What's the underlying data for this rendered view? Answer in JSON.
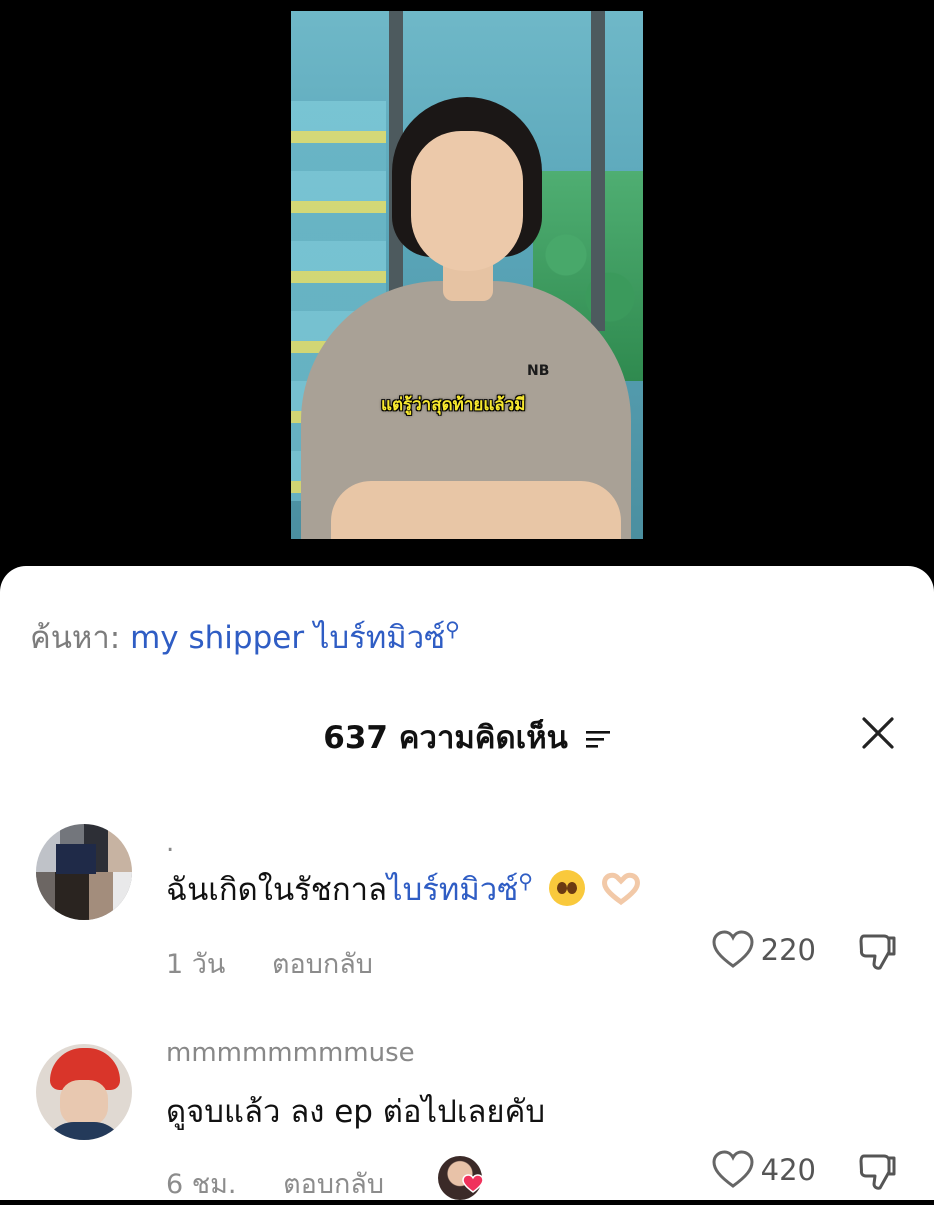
{
  "video": {
    "subtitle": "แต่รู้ว่าสุดท้ายแล้วมี",
    "shirt_logo": "NB"
  },
  "search": {
    "prefix": "ค้นหา:",
    "term": "my shipper ไบร์ทมิวซ์",
    "icon": "search-icon"
  },
  "comments_header": {
    "count_label": "637 ความคิดเห็น",
    "sort_icon": "sort-icon",
    "close_icon": "close-icon"
  },
  "comments": [
    {
      "username": ".",
      "text_plain": "ฉันเกิดในรัชกาล",
      "text_link": "ไบร์ทมิวซ์",
      "emojis": [
        "pleading-face-emoji",
        "heart-hands-emoji"
      ],
      "time": "1 วัน",
      "reply_label": "ตอบกลับ",
      "likes": "220"
    },
    {
      "username": "mmmmmmmmuse",
      "text_plain": "ดูจบแล้ว ลง ep ต่อไปเลยคับ",
      "time": "6 ชม.",
      "reply_label": "ตอบกลับ",
      "likes": "420",
      "liked_by_creator": true
    }
  ],
  "colors": {
    "link": "#2f5dc4",
    "muted": "#8c8c8c",
    "subtitle": "#f7e82f"
  }
}
